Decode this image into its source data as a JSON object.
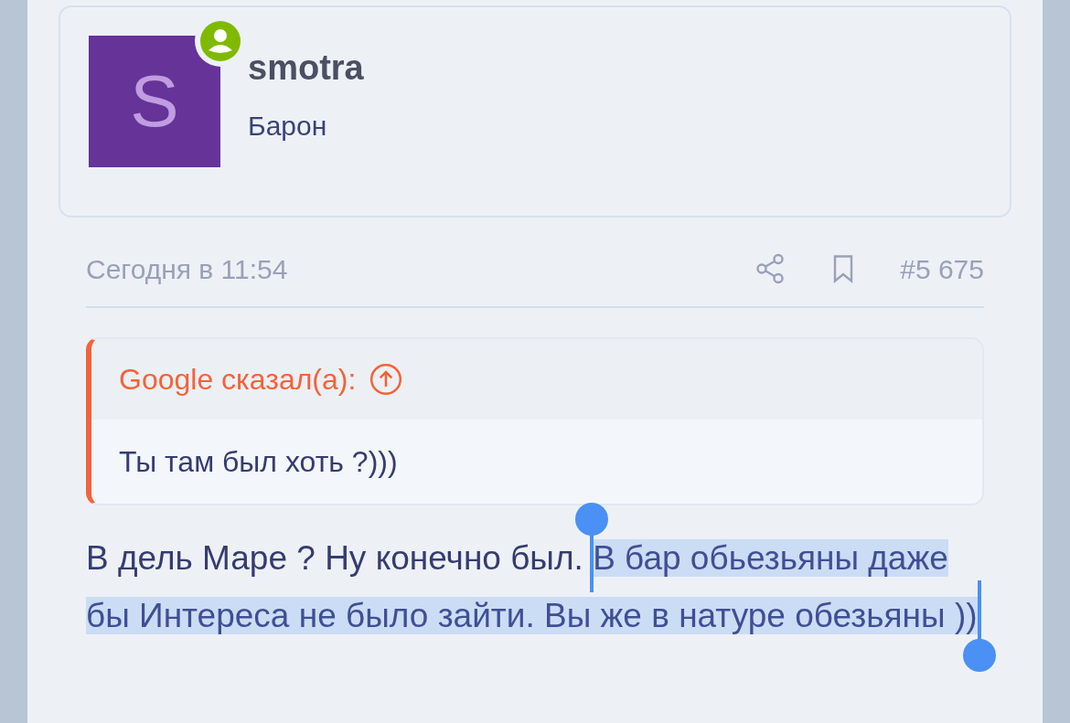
{
  "author": {
    "initial": "S",
    "name": "smotra",
    "title": "Барон",
    "online": true
  },
  "post": {
    "time": "Сегодня в 11:54",
    "number": "#5 675"
  },
  "quote": {
    "author_line": "Google сказал(а):",
    "text": "Ты там был хоть ?)))"
  },
  "body": {
    "text": "В дель Маре ? Ну конечно был. ",
    "selected_text": "В бар обьезьяны даже бы Интереса не было зайти. Вы же в натуре обезьяны ))"
  }
}
